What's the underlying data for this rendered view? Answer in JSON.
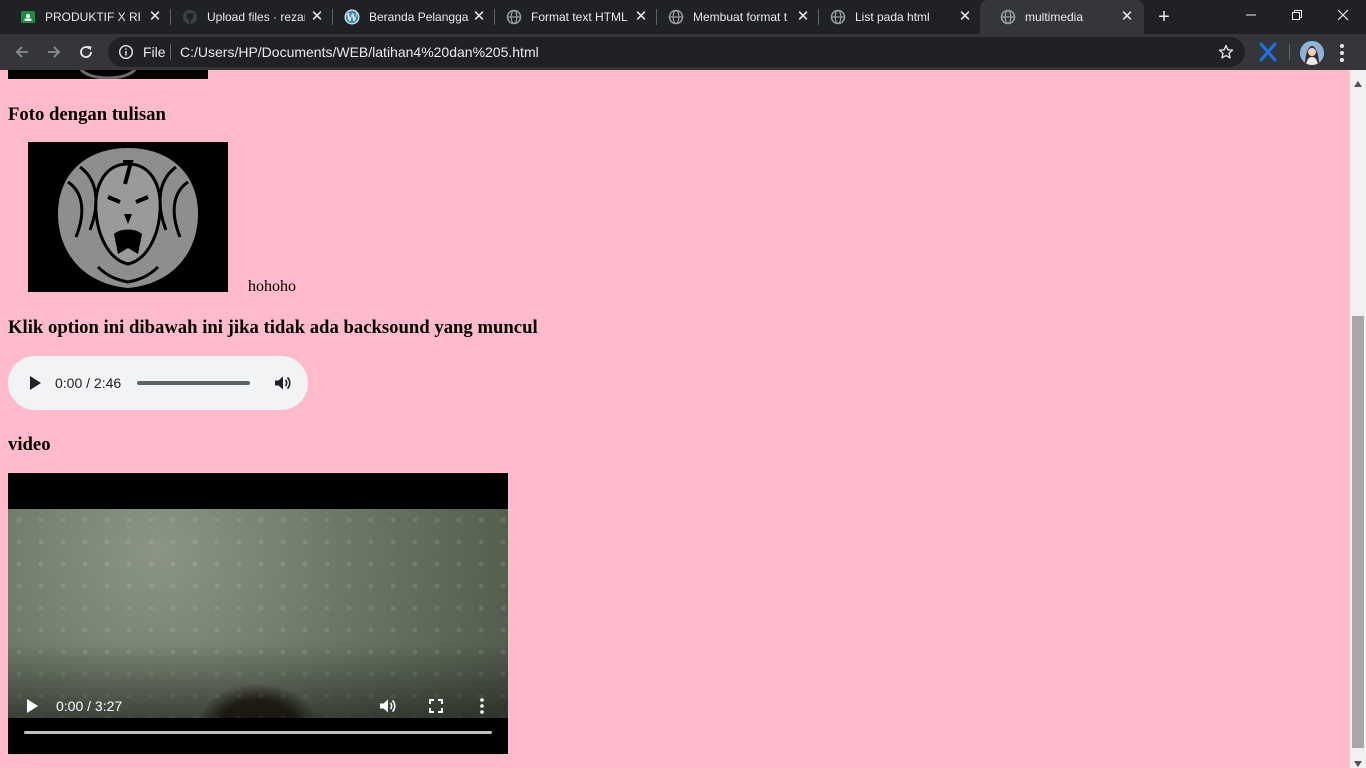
{
  "browser": {
    "tabs": [
      {
        "title": "PRODUKTIF X RPL",
        "favicon": "classroom-icon"
      },
      {
        "title": "Upload files · rezar",
        "favicon": "github-icon"
      },
      {
        "title": "Beranda Pelangga",
        "favicon": "wordpress-icon"
      },
      {
        "title": "Format text HTML",
        "favicon": "globe-icon"
      },
      {
        "title": "Membuat format t",
        "favicon": "globe-icon"
      },
      {
        "title": "List pada html",
        "favicon": "globe-icon"
      },
      {
        "title": "multimedia",
        "favicon": "globe-icon",
        "active": true
      }
    ],
    "new_tab_label": "+",
    "address_bar": {
      "scheme_label": "File",
      "url": "C:/Users/HP/Documents/WEB/latihan4%20dan%205.html"
    }
  },
  "page": {
    "background_color": "#ffbbcc",
    "photo_heading": "Foto dengan tulisan",
    "photo_caption": "hohoho",
    "audio_heading": "Klik option ini dibawah ini jika tidak ada backsound yang muncul",
    "audio_player": {
      "time": "0:00 / 2:46"
    },
    "video_heading": "video",
    "video_player": {
      "time": "0:00 / 3:27"
    }
  }
}
